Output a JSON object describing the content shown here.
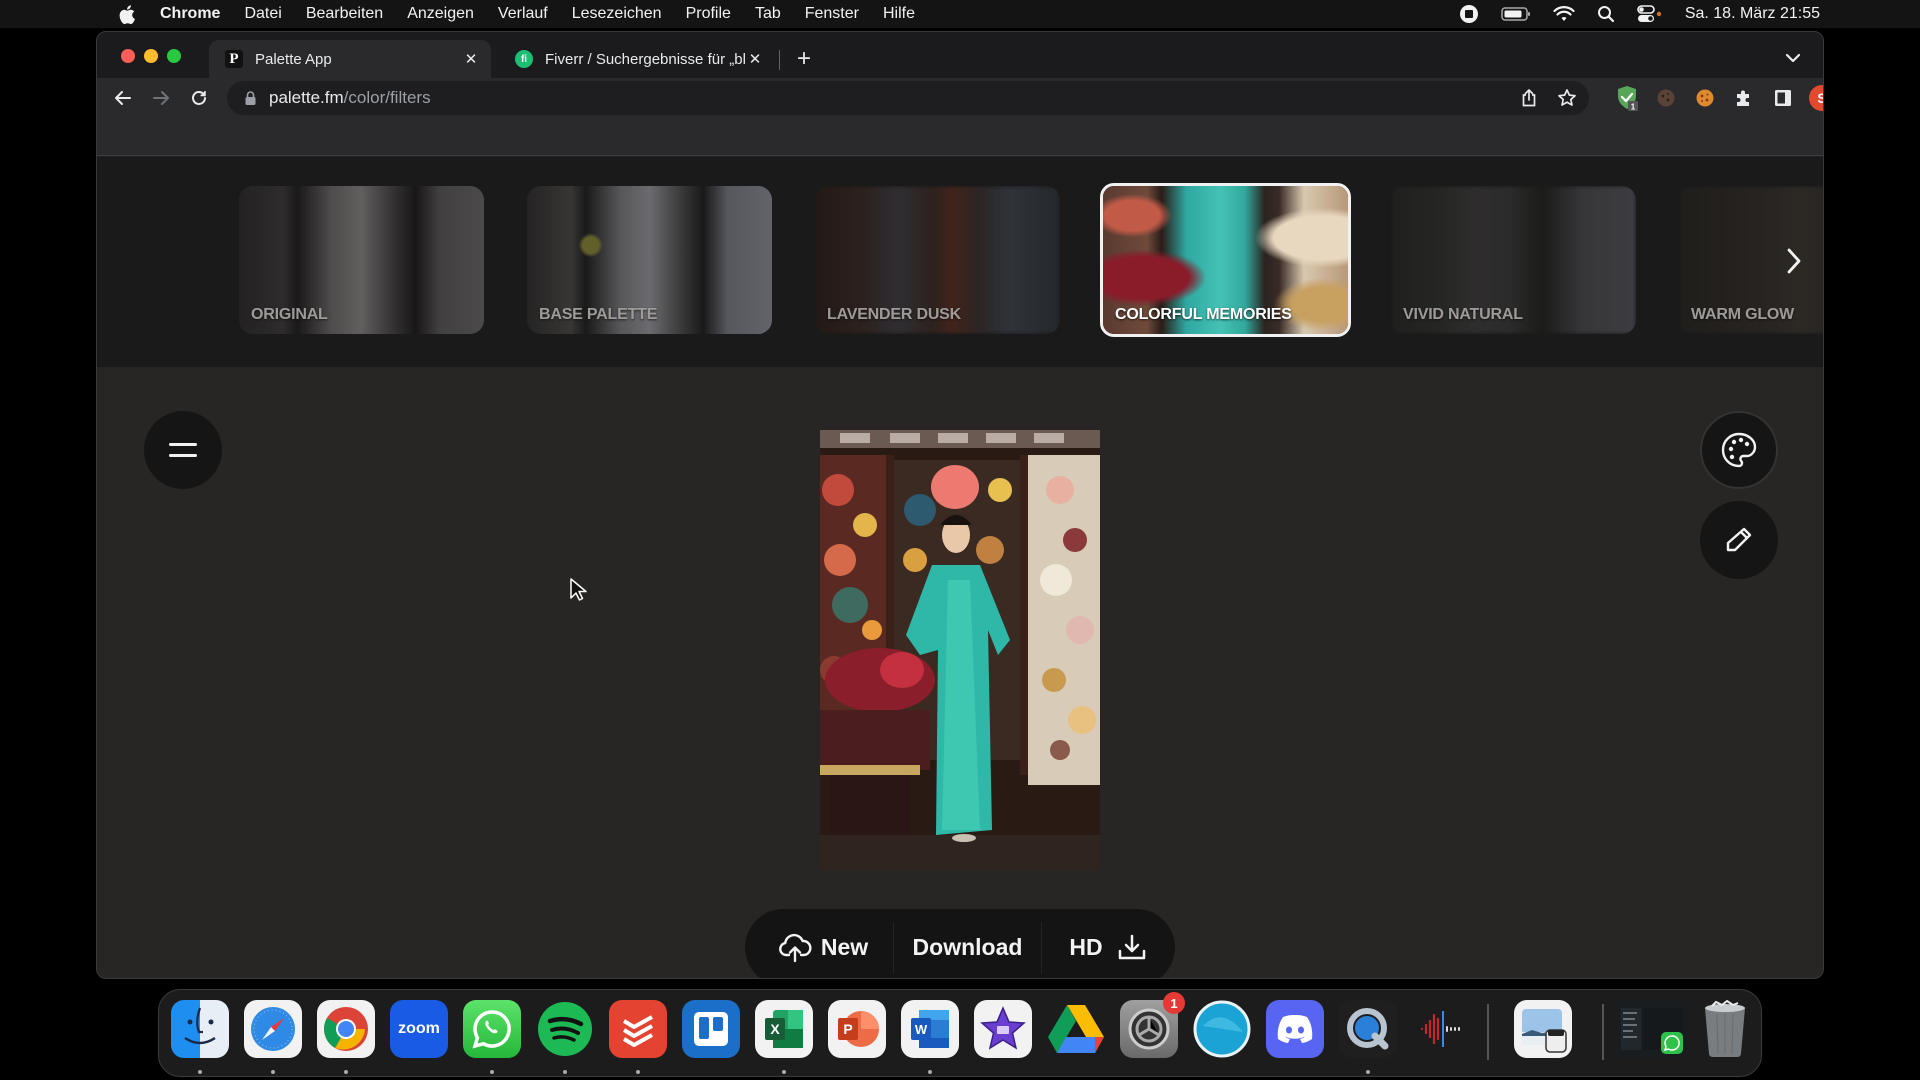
{
  "menubar": {
    "apple_icon": "apple-logo",
    "items": [
      "Chrome",
      "Datei",
      "Bearbeiten",
      "Anzeigen",
      "Verlauf",
      "Lesezeichen",
      "Profile",
      "Tab",
      "Fenster",
      "Hilfe"
    ],
    "status_icons": [
      "screen-record-icon",
      "battery-icon",
      "wifi-icon",
      "spotlight-search-icon",
      "control-center-icon"
    ],
    "clock": "Sa. 18. März  21:55"
  },
  "browser": {
    "tabs": [
      {
        "title": "Palette App",
        "favicon": "P",
        "active": true
      },
      {
        "title": "Fiverr / Suchergebnisse für „bl",
        "favicon": "fi",
        "active": false
      }
    ],
    "new_tab": "+",
    "url_host": "palette.fm",
    "url_path": "/color/filters",
    "extensions": [
      "adguard-icon",
      "cookie-icon",
      "cookie-editor-icon",
      "extensions-puzzle-icon",
      "side-panel-icon"
    ],
    "extension_badge": "1",
    "profile_initial": "S"
  },
  "filters": {
    "items": [
      {
        "label": "ORIGINAL",
        "selected": false
      },
      {
        "label": "BASE PALETTE",
        "selected": false
      },
      {
        "label": "LAVENDER DUSK",
        "selected": false
      },
      {
        "label": "COLORFUL MEMORIES",
        "selected": true
      },
      {
        "label": "VIVID NATURAL",
        "selected": false
      },
      {
        "label": "WARM GLOW",
        "selected": false
      }
    ],
    "next_icon": "chevron-right-icon"
  },
  "actions": {
    "new_label": "New",
    "download_label": "Download",
    "hd_label": "HD"
  },
  "side_buttons": {
    "menu": "menu-icon",
    "palette": "palette-icon",
    "edit": "pencil-icon"
  },
  "dock": {
    "apps": [
      "Finder",
      "Safari",
      "Chrome",
      "Zoom",
      "WhatsApp",
      "Spotify",
      "Todoist",
      "Trello",
      "Excel",
      "PowerPoint",
      "Word",
      "iMovie",
      "Google Drive",
      "System Settings",
      "Siri",
      "Discord",
      "QuickTime Player",
      "Voice Memos",
      "Preview",
      "WhatsApp Window",
      "Trash"
    ],
    "zoom_label": "zoom",
    "settings_badge": "1"
  },
  "colors": {
    "page_bg": "#272624",
    "strip_bg": "#1b1a1a",
    "action_bar_bg": "#141414",
    "selected_border": "#f1f1f1",
    "profile_red": "#e5492d"
  }
}
